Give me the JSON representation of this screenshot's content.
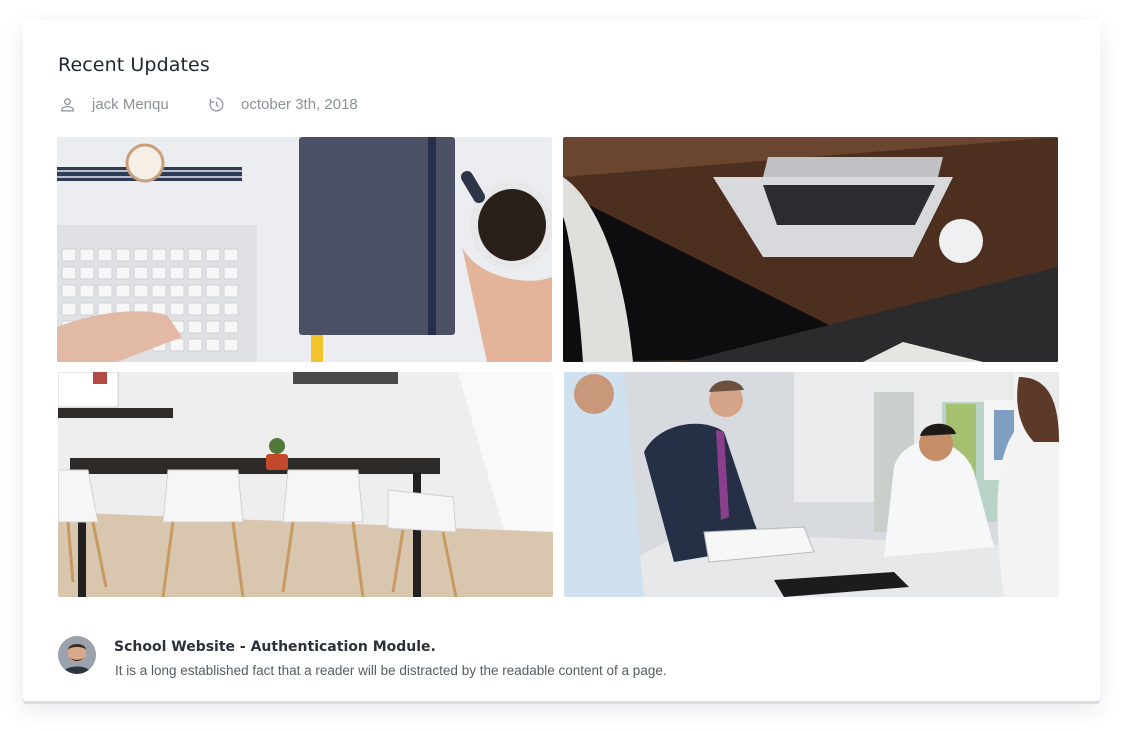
{
  "card": {
    "title": "Recent Updates",
    "author": "jack Menqu",
    "date": "october 3th, 2018",
    "author_icon": "user-icon",
    "date_icon": "clock-icon"
  },
  "gallery": [
    {
      "name": "workspace-keyboard-notebook-coffee-photo"
    },
    {
      "name": "laptop-on-wooden-desk-photo"
    },
    {
      "name": "meeting-room-chairs-photo"
    },
    {
      "name": "business-meeting-photo"
    }
  ],
  "post": {
    "title": "School Website - Authentication Module.",
    "text": "It is a long established fact that a reader will be distracted by the readable content of a page."
  },
  "colors": {
    "title": "#1f2630",
    "meta": "#8b929a",
    "shadow_bar": "#d9dde3"
  }
}
